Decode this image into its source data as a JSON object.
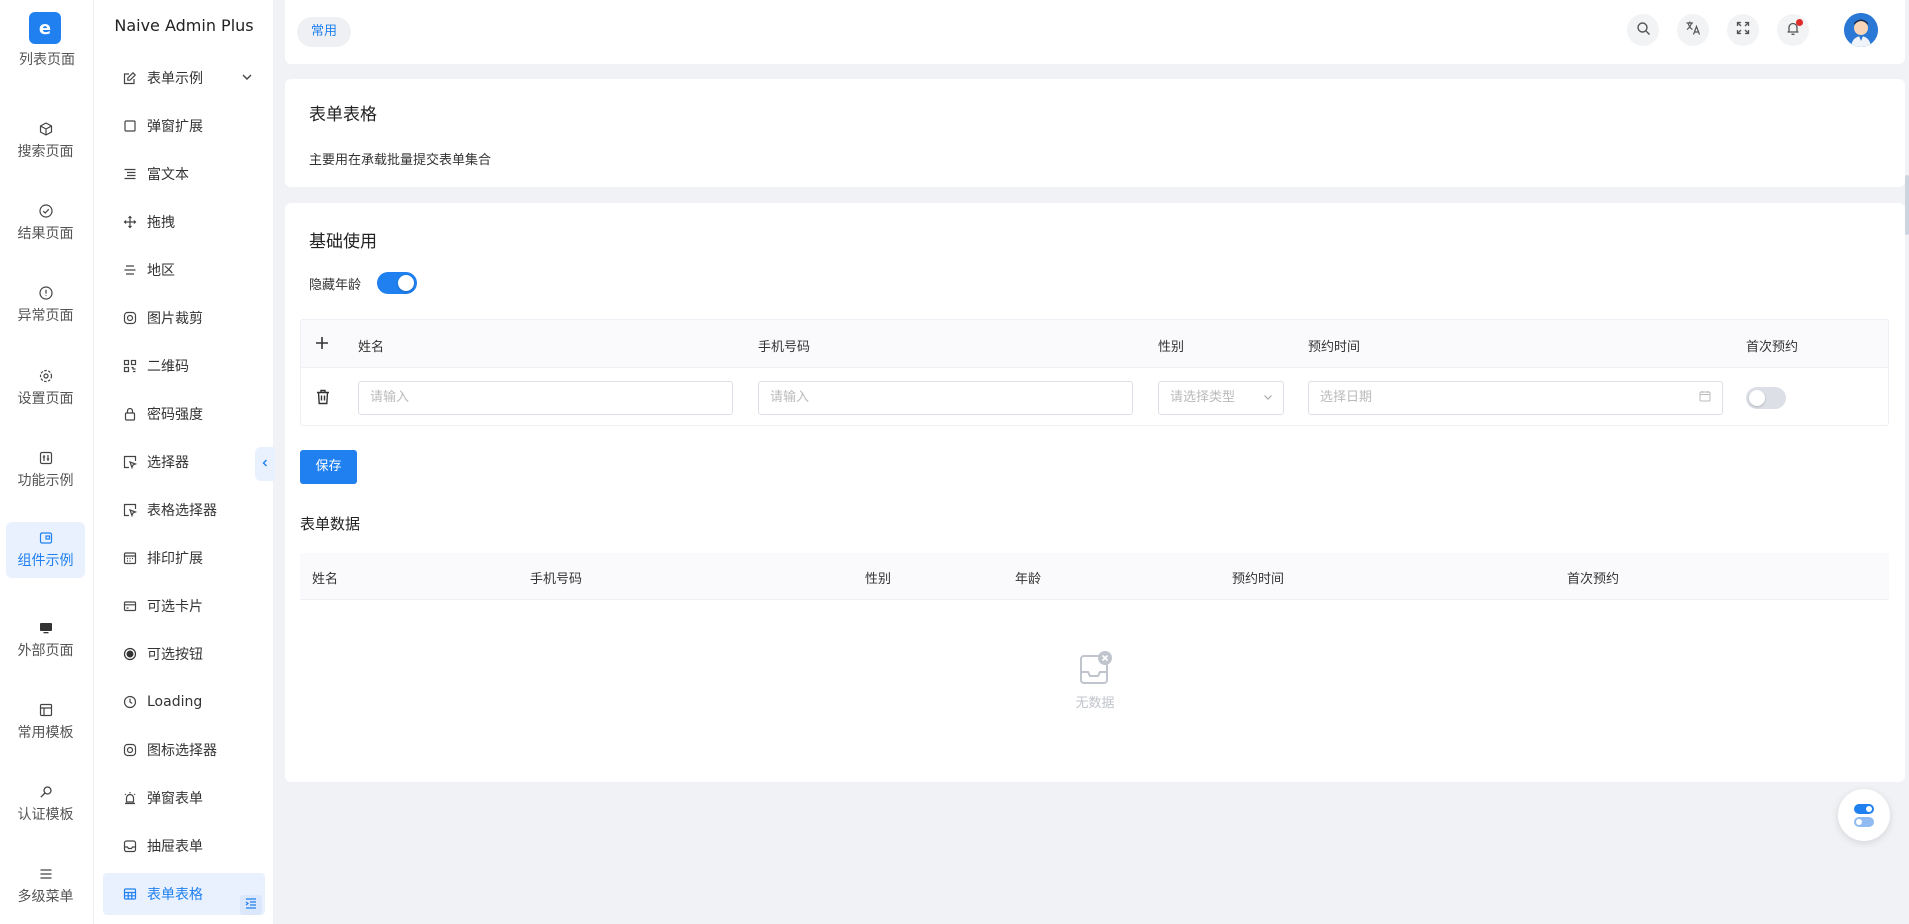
{
  "app": {
    "title": "Naive Admin Plus",
    "logo_icon": "e-logo-icon",
    "accent": "#2080f0"
  },
  "rail": {
    "cut_label": "列表页面",
    "items": [
      {
        "label": "搜索页面",
        "icon": "cube-icon"
      },
      {
        "label": "结果页面",
        "icon": "check-circle-icon"
      },
      {
        "label": "异常页面",
        "icon": "alert-circle-icon"
      },
      {
        "label": "设置页面",
        "icon": "gear-icon"
      },
      {
        "label": "功能示例",
        "icon": "sliders-icon"
      },
      {
        "label": "组件示例",
        "icon": "component-icon",
        "active": true
      },
      {
        "label": "外部页面",
        "icon": "monitor-icon"
      },
      {
        "label": "常用模板",
        "icon": "layout-icon"
      },
      {
        "label": "认证模板",
        "icon": "key-icon"
      },
      {
        "label": "多级菜单",
        "icon": "menu-icon"
      }
    ]
  },
  "submenu": {
    "items": [
      {
        "label": "表单示例",
        "icon": "edit-icon",
        "expandable": true
      },
      {
        "label": "弹窗扩展",
        "icon": "square-icon"
      },
      {
        "label": "富文本",
        "icon": "text-align-icon"
      },
      {
        "label": "拖拽",
        "icon": "move-icon"
      },
      {
        "label": "地区",
        "icon": "align-center-icon"
      },
      {
        "label": "图片裁剪",
        "icon": "instagram-icon"
      },
      {
        "label": "二维码",
        "icon": "qrcode-icon"
      },
      {
        "label": "密码强度",
        "icon": "lock-icon"
      },
      {
        "label": "选择器",
        "icon": "pointer-box-icon"
      },
      {
        "label": "表格选择器",
        "icon": "pointer-box-icon"
      },
      {
        "label": "排印扩展",
        "icon": "calendar-grid-icon"
      },
      {
        "label": "可选卡片",
        "icon": "credit-card-icon"
      },
      {
        "label": "可选按钮",
        "icon": "radio-dot-icon"
      },
      {
        "label": "Loading",
        "icon": "clock-icon"
      },
      {
        "label": "图标选择器",
        "icon": "instagram-icon"
      },
      {
        "label": "弹窗表单",
        "icon": "alarm-icon"
      },
      {
        "label": "抽屉表单",
        "icon": "inbox-icon"
      },
      {
        "label": "表单表格",
        "icon": "table-icon",
        "active": true
      }
    ]
  },
  "header": {
    "tag": "常用",
    "buttons": [
      "search-icon",
      "translate-icon",
      "fullscreen-icon",
      "bell-icon"
    ]
  },
  "intro": {
    "title": "表单表格",
    "description": "主要用在承载批量提交表单集合"
  },
  "basic": {
    "title": "基础使用",
    "hide_age_label": "隐藏年龄",
    "hide_age_on": true,
    "columns": {
      "name": "姓名",
      "phone": "手机号码",
      "gender": "性别",
      "time": "预约时间",
      "first": "首次预约"
    },
    "row": {
      "name_placeholder": "请输入",
      "phone_placeholder": "请输入",
      "gender_placeholder": "请选择类型",
      "date_placeholder": "选择日期",
      "first_on": false
    },
    "save_label": "保存"
  },
  "form_data": {
    "title": "表单数据",
    "columns": [
      "姓名",
      "手机号码",
      "性别",
      "年龄",
      "预约时间",
      "首次预约"
    ],
    "empty_text": "无数据"
  }
}
